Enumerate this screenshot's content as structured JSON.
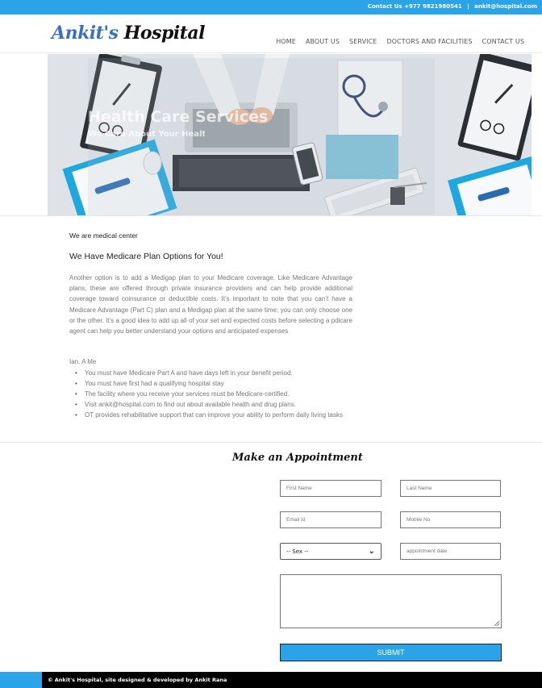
{
  "topbar": {
    "contact_phone": "Contact Us +977 9821980541",
    "separator": "|",
    "contact_email": "ankit@hospital.com"
  },
  "header": {
    "logo_part1": "Ankit's",
    "logo_part2": "Hospital",
    "nav": [
      "HOME",
      "ABOUT US",
      "SERVICE",
      "DOCTORS AND FACILITIES",
      "CONTACT US"
    ]
  },
  "hero": {
    "title": "Health Care Services",
    "subtitle": "We Care About Your Health"
  },
  "content": {
    "intro": "We are medical center",
    "heading": "We Have Medicare Plan Options for You!",
    "paragraph": "Another option is to add a Medigap plan to your Medicare coverage. Like Medicare Advantage plans, these are offered through private insurance providers and can help provide additional coverage toward coinsurance or deductible costs. It’s important to note that you can’t have a Medicare Advantage (Part C) plan and a Medigap plan at the same time; you can only choose one or the other. It’s a good idea to add up all of your set and expected costs before selecting a pdicare agent can help you better understand your options and anticipated expenses",
    "list_title": "Ian. A Me",
    "list": [
      "You must have Medicare Part A and have days left in your benefit period.",
      "You must have first had a qualifying hospital stay",
      "The facility where you receive your services must be Medicare-certified.",
      "Visit ankit@hospital.com to find out about available health and drug plans.",
      "OT provides rehabilitative support that can improve your ability to perform daily living tasks"
    ]
  },
  "appointment": {
    "title": "Make an Appointment",
    "first_name_placeholder": "First Name",
    "last_name_placeholder": "Last Name",
    "email_placeholder": "Email Id",
    "mobile_placeholder": "Mobile No",
    "sex_selected": "-- Sex --",
    "date_placeholder": "appointment date",
    "submit_label": "SUBMIT"
  },
  "footer": {
    "text": "© Ankit's Hospital, site designed & developed by Ankit Rana"
  },
  "colors": {
    "accent": "#2aa3e8",
    "logo_blue": "#3b6fc4",
    "footer_bg": "#000000"
  },
  "icons": {
    "select_chevron": "chevron-down-icon",
    "textarea_grip": "resize-grip-icon"
  }
}
